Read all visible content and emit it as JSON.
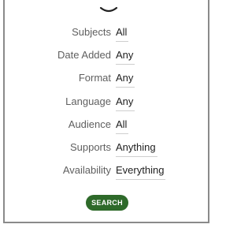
{
  "icons": {
    "collapse": "chevron-down-icon"
  },
  "filters": [
    {
      "label": "Subjects",
      "value": "All"
    },
    {
      "label": "Date Added",
      "value": "Any"
    },
    {
      "label": "Format",
      "value": "Any"
    },
    {
      "label": "Language",
      "value": "Any"
    },
    {
      "label": "Audience",
      "value": "All"
    },
    {
      "label": "Supports",
      "value": "Anything"
    },
    {
      "label": "Availability",
      "value": "Everything"
    }
  ],
  "search_button": {
    "label": "SEARCH"
  },
  "colors": {
    "button_bg": "#2e6a2a",
    "button_text": "#ffffff",
    "label_text": "#5f5f5f",
    "value_text": "#222222",
    "border": "#8a8a8a"
  }
}
